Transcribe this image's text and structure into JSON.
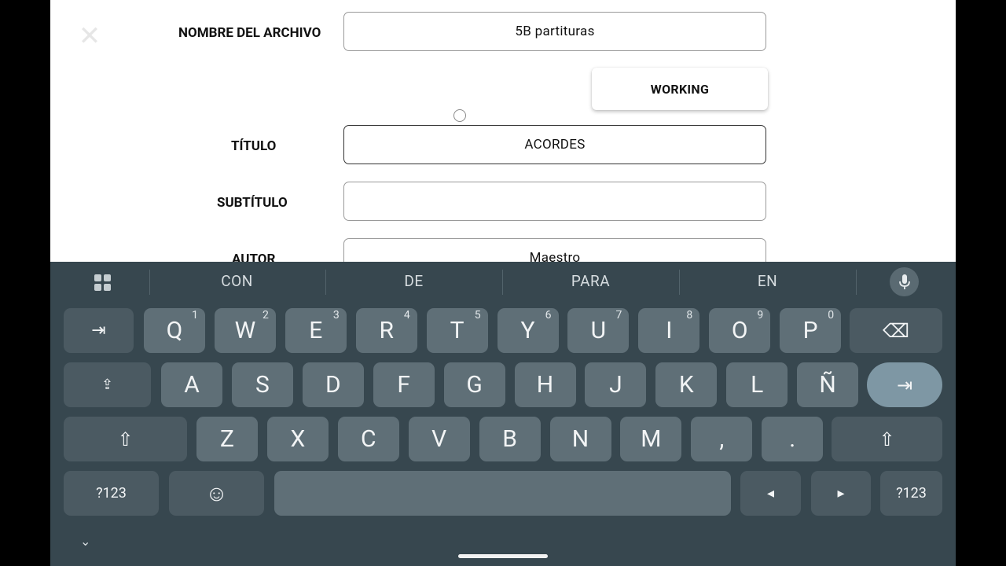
{
  "form": {
    "file_name_label": "NOMBRE DEL ARCHIVO",
    "file_name_value": "5B partituras",
    "working_button": "WORKING",
    "title_label": "TÍTULO",
    "title_value": "ACORDES",
    "subtitle_label": "SUBTÍTULO",
    "subtitle_value": "",
    "author_label": "AUTOR",
    "author_value": "Maestro"
  },
  "keyboard": {
    "suggestions": [
      "CON",
      "DE",
      "PARA",
      "EN"
    ],
    "row1": [
      {
        "k": "Q",
        "h": "1"
      },
      {
        "k": "W",
        "h": "2"
      },
      {
        "k": "E",
        "h": "3"
      },
      {
        "k": "R",
        "h": "4"
      },
      {
        "k": "T",
        "h": "5"
      },
      {
        "k": "Y",
        "h": "6"
      },
      {
        "k": "U",
        "h": "7"
      },
      {
        "k": "I",
        "h": "8"
      },
      {
        "k": "O",
        "h": "9"
      },
      {
        "k": "P",
        "h": "0"
      }
    ],
    "row2": [
      "A",
      "S",
      "D",
      "F",
      "G",
      "H",
      "J",
      "K",
      "L",
      "Ñ"
    ],
    "row3": [
      "Z",
      "X",
      "C",
      "V",
      "B",
      "N",
      "M",
      ",",
      "."
    ],
    "symbols_label": "?123",
    "tab_glyph": "⇥",
    "backspace_glyph": "⌫",
    "caps_glyph": "⇪",
    "shift_glyph": "⇧",
    "emoji_glyph": "☺",
    "left_glyph": "◂",
    "right_glyph": "▸",
    "collapse_glyph": "⌄"
  },
  "colors": {
    "keyboard_bg": "#37474f",
    "key_bg": "#5f6f77",
    "key_dark_bg": "#4b5a62",
    "accent_key_bg": "#7e97a4"
  }
}
